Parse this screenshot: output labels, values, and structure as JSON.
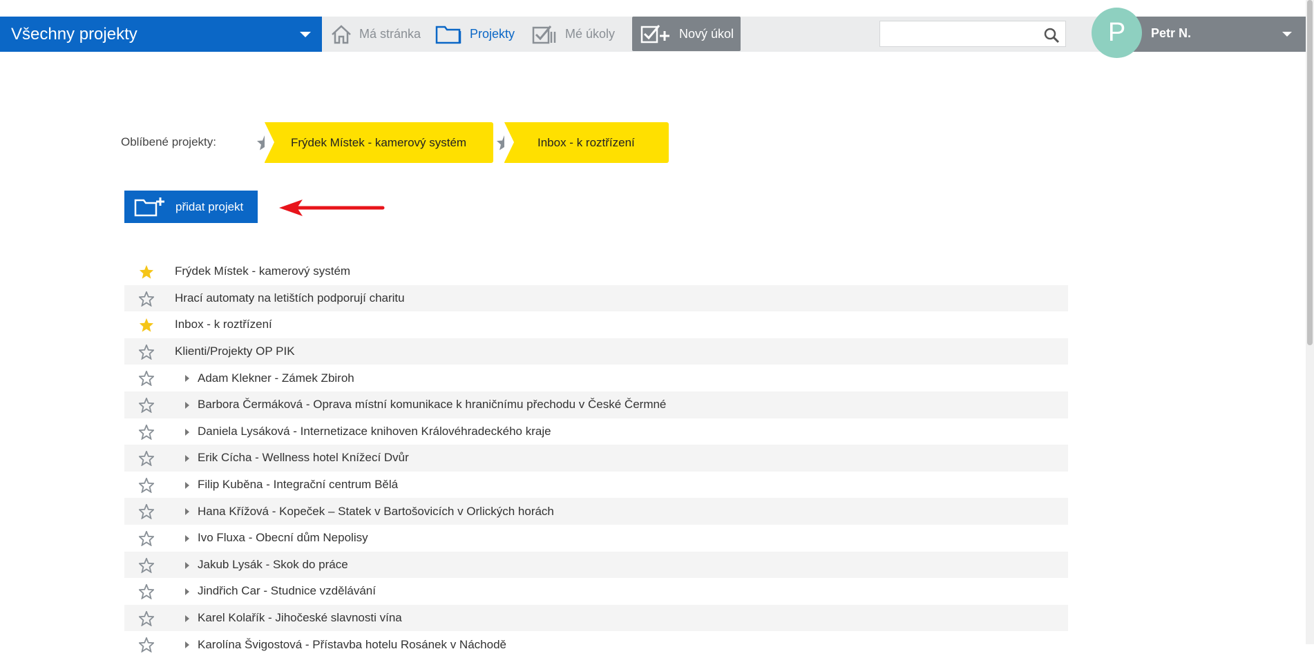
{
  "topbar": {
    "project_selector": "Všechny projekty",
    "nav": {
      "home": "Má stránka",
      "projects": "Projekty",
      "my_tasks": "Mé úkoly"
    },
    "new_task": "Nový úkol",
    "search": {
      "value": "",
      "placeholder": ""
    },
    "user": {
      "initial": "P",
      "name": "Petr N."
    }
  },
  "favorites": {
    "label": "Oblíbené projekty:",
    "items": [
      "Frýdek Místek - kamerový systém",
      "Inbox - k roztřízení"
    ]
  },
  "add_project": "přidat projekt",
  "projects": [
    {
      "name": "Frýdek Místek - kamerový systém",
      "starred": true,
      "level": 0
    },
    {
      "name": "Hrací automaty na letištích podporují charitu",
      "starred": false,
      "level": 0
    },
    {
      "name": "Inbox - k roztřízení",
      "starred": true,
      "level": 0
    },
    {
      "name": "Klienti/Projekty OP PIK",
      "starred": false,
      "level": 0
    },
    {
      "name": "Adam Klekner - Zámek Zbiroh",
      "starred": false,
      "level": 1
    },
    {
      "name": "Barbora Čermáková - Oprava místní komunikace k hraničnímu přechodu v České Čermné",
      "starred": false,
      "level": 1
    },
    {
      "name": "Daniela Lysáková - Internetizace knihoven Královéhradeckého kraje",
      "starred": false,
      "level": 1
    },
    {
      "name": "Erik Cícha - Wellness hotel Knížecí Dvůr",
      "starred": false,
      "level": 1
    },
    {
      "name": "Filip Kuběna - Integrační centrum Bělá",
      "starred": false,
      "level": 1
    },
    {
      "name": "Hana Křížová - Kopeček – Statek v Bartošovicích v Orlických horách",
      "starred": false,
      "level": 1
    },
    {
      "name": "Ivo Fluxa - Obecní dům Nepolisy",
      "starred": false,
      "level": 1
    },
    {
      "name": "Jakub Lysák - Skok do práce",
      "starred": false,
      "level": 1
    },
    {
      "name": "Jindřich Car - Studnice vzdělávání",
      "starred": false,
      "level": 1
    },
    {
      "name": "Karel Kolařík - Jihočeské slavnosti vína",
      "starred": false,
      "level": 1
    },
    {
      "name": "Karolína Švigostová - Přístavba hotelu Rosánek v Náchodě",
      "starred": false,
      "level": 1
    }
  ],
  "colors": {
    "brand_blue": "#0b67c6",
    "favorite_yellow": "#ffe000",
    "star_filled": "#f5c518",
    "star_outline": "#888f96",
    "toolbar_gray": "#7d8389",
    "avatar_teal": "#8ed0c0",
    "annotation_arrow": "#e8141b"
  },
  "icons": {
    "home": "home-icon",
    "projects": "folder-icon",
    "my_tasks": "checklist-icon",
    "new_task": "add-task-icon",
    "search": "search-icon",
    "add_project": "folder-add-icon",
    "star": "star-icon",
    "expander": "caret-right-icon"
  }
}
